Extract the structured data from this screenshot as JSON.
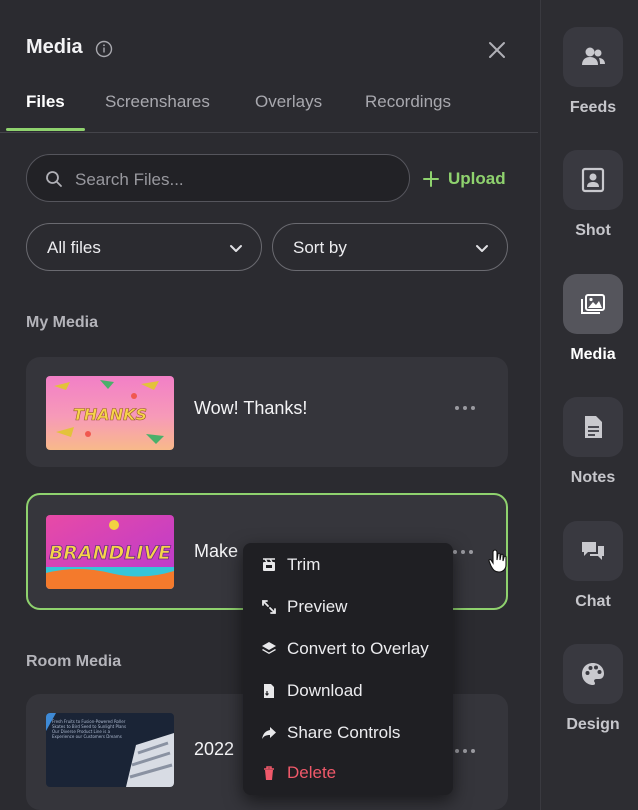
{
  "panel": {
    "title": "Media",
    "tabs": [
      {
        "label": "Files",
        "active": true
      },
      {
        "label": "Screenshares",
        "active": false
      },
      {
        "label": "Overlays",
        "active": false
      },
      {
        "label": "Recordings",
        "active": false
      }
    ],
    "search": {
      "placeholder": "Search Files...",
      "value": ""
    },
    "upload_label": "Upload",
    "filter": {
      "selected": "All files"
    },
    "sort": {
      "selected": "Sort by"
    },
    "my_media": {
      "heading": "My Media",
      "items": [
        {
          "name": "Wow! Thanks!",
          "thumb_text": "THANKS"
        },
        {
          "name": "Make ",
          "thumb_text": "BRANDLIVE",
          "selected": true
        }
      ]
    },
    "room_media": {
      "heading": "Room Media",
      "items": [
        {
          "name": "2022",
          "thumb_text": "Fresh Fruits to Fusion-Powered Roller Skates to Bird Seed to Sunlight Plans Our Diverse Product Line is a Experience our Customers Dreams"
        }
      ]
    }
  },
  "context_menu": {
    "items": [
      {
        "label": "Trim",
        "icon": "trim-icon"
      },
      {
        "label": "Preview",
        "icon": "expand-icon"
      },
      {
        "label": "Convert to Overlay",
        "icon": "layers-icon"
      },
      {
        "label": "Download",
        "icon": "file-icon"
      },
      {
        "label": "Share Controls",
        "icon": "share-icon"
      },
      {
        "label": "Delete",
        "icon": "trash-icon",
        "danger": true
      }
    ]
  },
  "rail": {
    "items": [
      {
        "label": "Feeds",
        "icon": "users-icon"
      },
      {
        "label": "Shot",
        "icon": "portrait-icon"
      },
      {
        "label": "Media",
        "icon": "images-icon",
        "active": true
      },
      {
        "label": "Notes",
        "icon": "document-icon"
      },
      {
        "label": "Chat",
        "icon": "chat-icon"
      },
      {
        "label": "Design",
        "icon": "palette-icon"
      }
    ]
  },
  "colors": {
    "accent": "#8fd26e",
    "danger": "#f0596a",
    "background": "#2b2b30"
  }
}
